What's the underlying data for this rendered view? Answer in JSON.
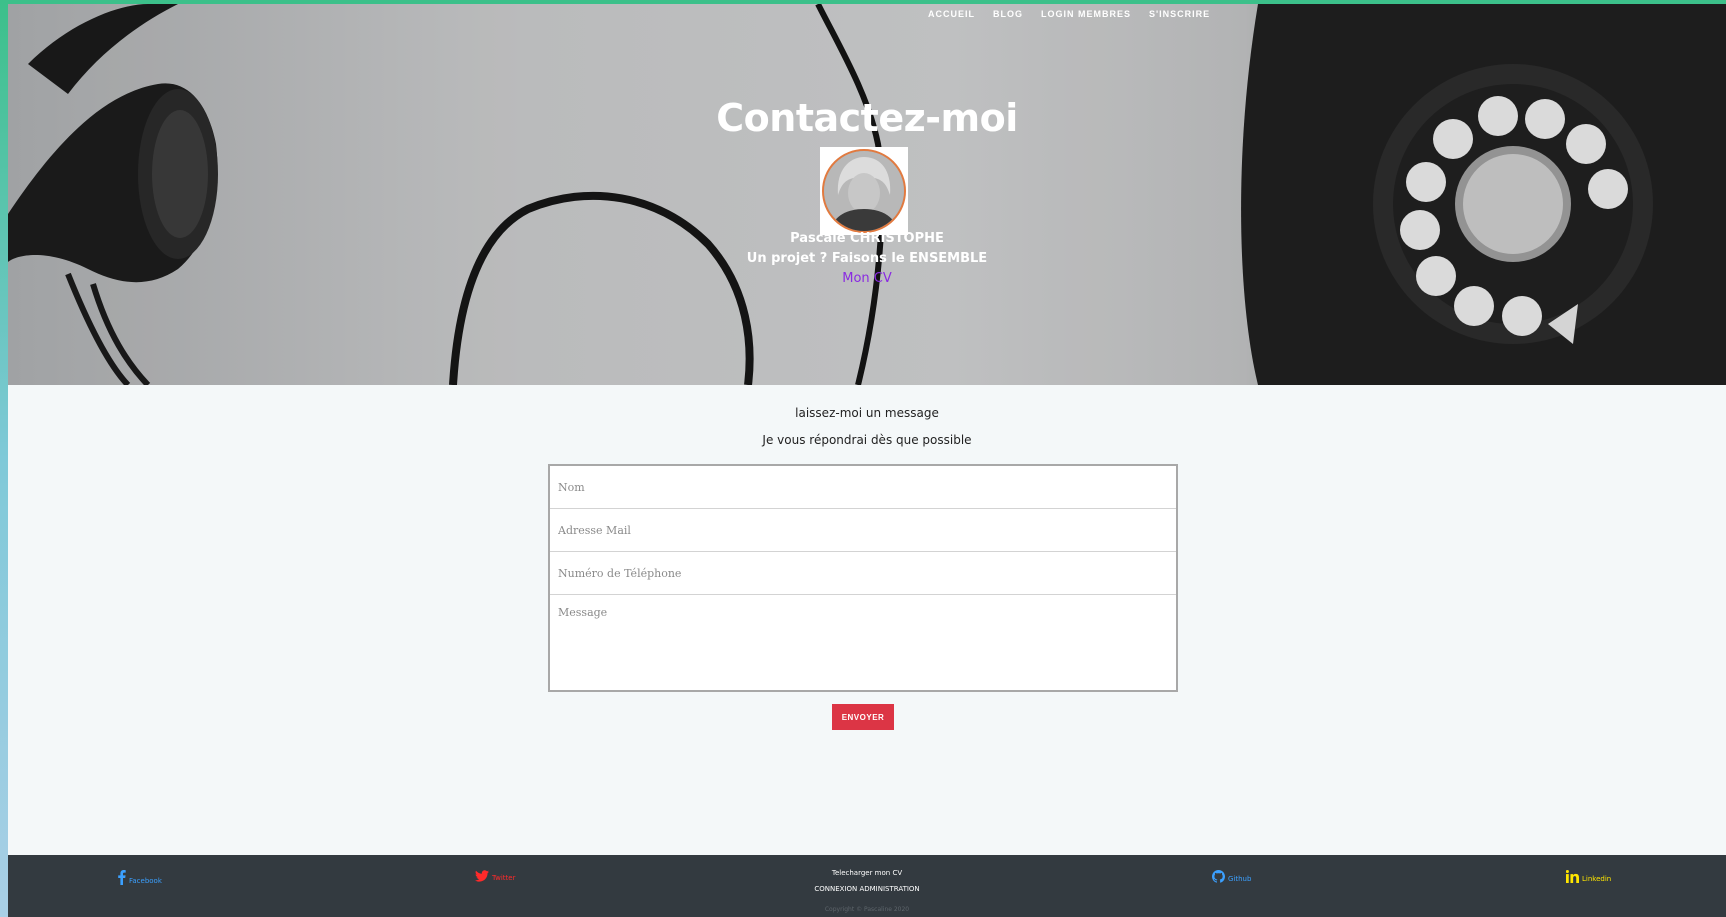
{
  "nav": {
    "items": [
      "ACCUEIL",
      "BLOG",
      "LOGIN MEMBRES",
      "S'INSCRIRE"
    ]
  },
  "hero": {
    "title": "Contactez-moi",
    "name": "Pascale CHRISTOPHE",
    "tagline": "Un projet ? Faisons le ENSEMBLE",
    "cv_link": "Mon CV"
  },
  "contact": {
    "intro": "laissez-moi un message",
    "subintro": "Je vous répondrai dès que possible",
    "fields": {
      "name_placeholder": "Nom",
      "email_placeholder": "Adresse Mail",
      "phone_placeholder": "Numéro de Téléphone",
      "message_placeholder": "Message"
    },
    "submit_label": "ENVOYER"
  },
  "footer": {
    "facebook": "Facebook",
    "twitter": "Twitter",
    "cv_download": "Telecharger mon CV",
    "admin": "CONNEXION ADMINISTRATION",
    "github": "Github",
    "linkedin": "Linkedin",
    "copyright": "Copyright © Pascaline 2020"
  },
  "icons": {
    "facebook": "facebook-icon",
    "twitter": "twitter-icon",
    "github": "github-icon",
    "linkedin": "linkedin-icon"
  },
  "colors": {
    "accent_button": "#dc3545",
    "cv_link": "#8a2be2",
    "footer_bg": "#333a40",
    "facebook": "#3ba0ff",
    "twitter": "#ff2a2a",
    "github": "#3ba0ff",
    "linkedin": "#ffe600"
  }
}
